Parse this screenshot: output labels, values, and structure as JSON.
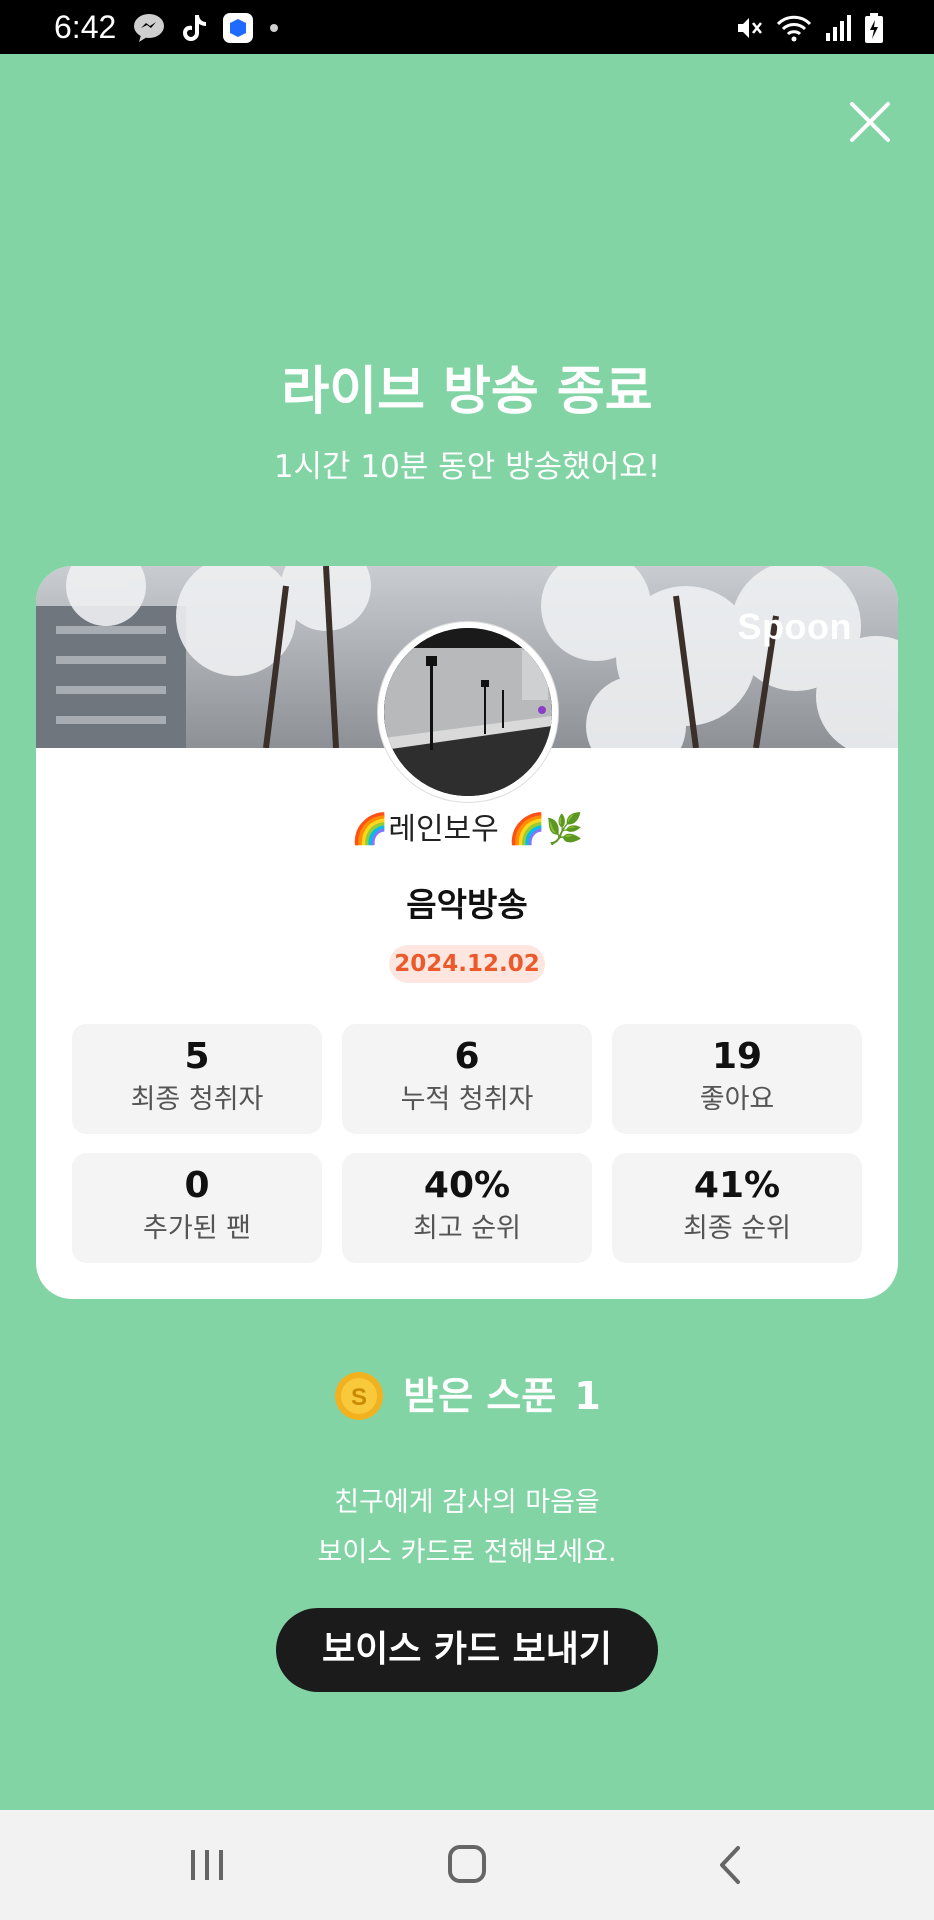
{
  "status_bar": {
    "time": "6:42",
    "left_icons": [
      "messenger-icon",
      "tiktok-icon",
      "app-icon",
      "dot-icon"
    ],
    "right_icons": [
      "mute-icon",
      "wifi-icon",
      "signal-icon",
      "battery-icon"
    ]
  },
  "header": {
    "title": "라이브 방송 종료",
    "subtitle": "1시간 10분 동안 방송했어요!"
  },
  "card": {
    "brand": "Spoon",
    "nickname": "🌈레인보우 🌈🌿",
    "stream_title": "음악방송",
    "date": "2024.12.02",
    "stats": [
      {
        "value": "5",
        "label": "최종 청취자"
      },
      {
        "value": "6",
        "label": "누적 청취자"
      },
      {
        "value": "19",
        "label": "좋아요"
      },
      {
        "value": "0",
        "label": "추가된 팬"
      },
      {
        "value": "40%",
        "label": "최고 순위"
      },
      {
        "value": "41%",
        "label": "최종 순위"
      }
    ]
  },
  "spoon": {
    "label": "받은 스푼",
    "count": "1",
    "coin_letter": "S"
  },
  "thanks": {
    "line1": "친구에게 감사의 마음을",
    "line2": "보이스 카드로 전해보세요."
  },
  "cta": {
    "label": "보이스 카드 보내기"
  },
  "colors": {
    "background": "#82d4a5",
    "date_badge_text": "#ec5a2b",
    "date_badge_bg": "#fde6df",
    "button_bg": "#1b1b1b"
  }
}
